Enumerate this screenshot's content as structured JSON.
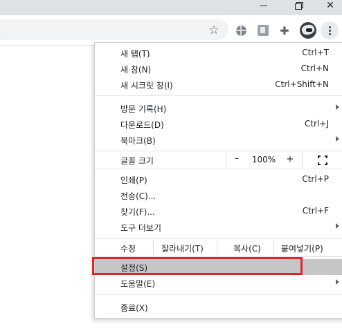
{
  "window": {
    "minimize_icon": "minimize-icon",
    "restore_icon": "restore-icon",
    "close_glyph": "✕"
  },
  "toolbar": {
    "bookmark_star": "☆",
    "extensions_glyph": "✚"
  },
  "menu": {
    "group1": [
      {
        "label": "새 탭(T)",
        "shortcut": "Ctrl+T"
      },
      {
        "label": "새 창(N)",
        "shortcut": "Ctrl+N"
      },
      {
        "label": "새 시크릿 창(I)",
        "shortcut": "Ctrl+Shift+N"
      }
    ],
    "group2": [
      {
        "label": "방문 기록(H)",
        "shortcut": "",
        "submenu": true
      },
      {
        "label": "다운로드(D)",
        "shortcut": "Ctrl+J"
      },
      {
        "label": "북마크(B)",
        "shortcut": "",
        "submenu": true
      }
    ],
    "zoom": {
      "label": "글꼴 크기",
      "minus": "–",
      "value": "100%",
      "plus": "+"
    },
    "group3": [
      {
        "label": "인쇄(P)",
        "shortcut": "Ctrl+P"
      },
      {
        "label": "전송(C)...",
        "shortcut": ""
      },
      {
        "label": "찾기(F)...",
        "shortcut": "Ctrl+F"
      },
      {
        "label": "도구 더보기",
        "shortcut": "",
        "submenu": true
      }
    ],
    "edit": {
      "label": "수정",
      "cut": "잘라내기(T)",
      "copy": "복사(C)",
      "paste": "붙여넣기(P)"
    },
    "group4": [
      {
        "label": "설정(S)",
        "shortcut": "",
        "highlighted": true
      },
      {
        "label": "도움말(E)",
        "shortcut": "",
        "submenu": true
      }
    ],
    "group5": [
      {
        "label": "종료(X)",
        "shortcut": ""
      }
    ]
  },
  "colors": {
    "highlight_outline": "#e0242b",
    "hover_bg": "#c6c6c6"
  }
}
